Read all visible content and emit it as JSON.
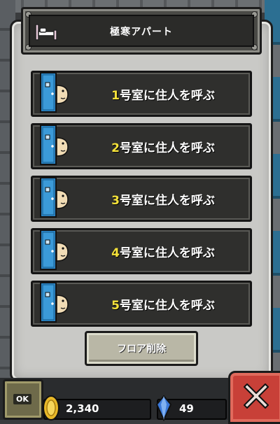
{
  "header": {
    "title": "極寒アパート",
    "icon": "bed-icon"
  },
  "rooms": [
    {
      "number": "1",
      "text": "号室に住人を呼ぶ"
    },
    {
      "number": "2",
      "text": "号室に住人を呼ぶ"
    },
    {
      "number": "3",
      "text": "号室に住人を呼ぶ"
    },
    {
      "number": "4",
      "text": "号室に住人を呼ぶ"
    },
    {
      "number": "5",
      "text": "号室に住人を呼ぶ"
    }
  ],
  "delete_button": {
    "label": "フロア削除"
  },
  "bottom_bar": {
    "ok_label": "OK",
    "coins": "2,340",
    "gems": "49"
  },
  "colors": {
    "number_accent": "#f4e13a",
    "door_blue": "#2a86c8",
    "close_red": "#c84038"
  }
}
